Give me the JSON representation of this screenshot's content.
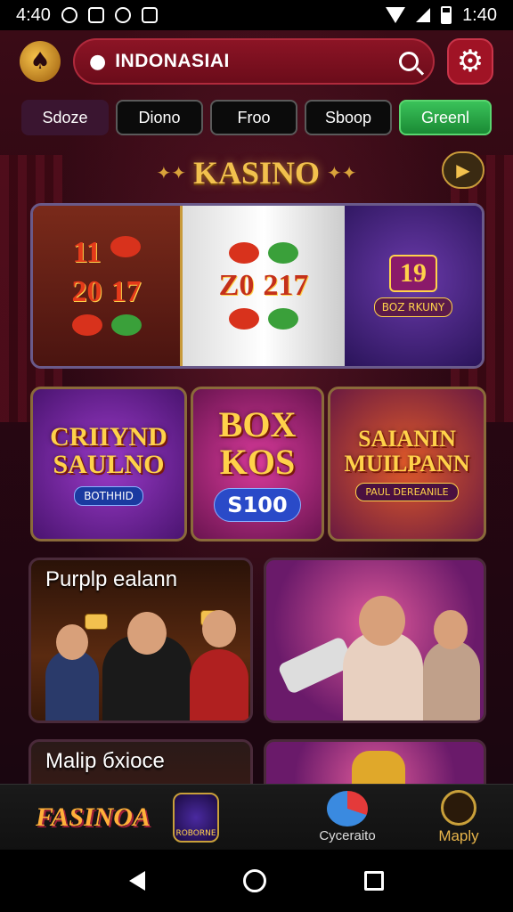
{
  "status_bar": {
    "time_left": "4:40",
    "time_right": "1:40"
  },
  "header": {
    "search_text": "INDONASIAI"
  },
  "tabs": [
    {
      "label": "Sdoze"
    },
    {
      "label": "Diono"
    },
    {
      "label": "Froo"
    },
    {
      "label": "Sboop"
    },
    {
      "label": "Greenl"
    }
  ],
  "section": {
    "title": "KASINO"
  },
  "slot_banner": {
    "reel_a": [
      "11",
      "20",
      "17"
    ],
    "reel_b": [
      "Z0",
      "217"
    ],
    "machine_num": "19",
    "machine_caption": "BOZ RKUNY"
  },
  "tiles": [
    {
      "title": "CRIIYND\nSAULNO",
      "badge": "BOTHHID"
    },
    {
      "title": "BOX\nKOS",
      "badge": "S100"
    },
    {
      "title": "SAIANIN\nMUILPANN",
      "badge": "PAUL DEREANILE"
    }
  ],
  "cards": [
    {
      "label": "Purplp ealann"
    },
    {
      "label": ""
    },
    {
      "label": "Malip бxioce"
    },
    {
      "label": ""
    }
  ],
  "bottom_nav": {
    "brand": "FASINOA",
    "badge_caption": "ROBORNE",
    "item_cyc": "Cyceraito",
    "item_maply": "Maply"
  },
  "colors": {
    "accent_gold": "#f2c14e",
    "header_red": "#8c1425",
    "green_tab": "#2aa648"
  }
}
